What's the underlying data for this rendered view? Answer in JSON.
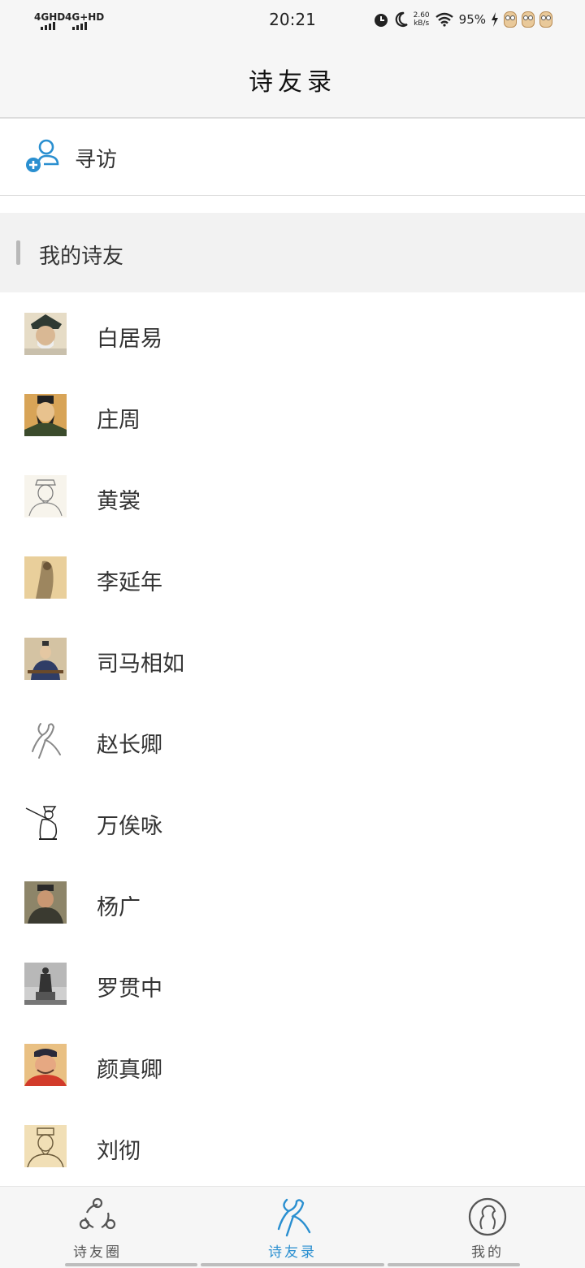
{
  "status_bar": {
    "signal_1": "4GHD",
    "signal_2": "4G+HD",
    "time": "20:21",
    "net_rate": "2.60",
    "net_unit": "kB/s",
    "battery": "95%",
    "icons": [
      "alarm-icon",
      "moon-icon",
      "wifi-icon",
      "charging-icon"
    ]
  },
  "header": {
    "title": "诗友录"
  },
  "visit": {
    "label": "寻访",
    "icon": "add-user-icon",
    "accent_color": "#2a8fd0"
  },
  "section": {
    "title": "我的诗友"
  },
  "friends": [
    {
      "name": "白居易",
      "avatar": "portrait-avatar"
    },
    {
      "name": "庄周",
      "avatar": "portrait-avatar"
    },
    {
      "name": "黄裳",
      "avatar": "sketch-portrait-avatar"
    },
    {
      "name": "李延年",
      "avatar": "portrait-avatar"
    },
    {
      "name": "司马相如",
      "avatar": "portrait-avatar"
    },
    {
      "name": "赵长卿",
      "avatar": "default-figure-avatar"
    },
    {
      "name": "万俟咏",
      "avatar": "ink-figure-avatar"
    },
    {
      "name": "杨广",
      "avatar": "portrait-avatar"
    },
    {
      "name": "罗贯中",
      "avatar": "statue-avatar"
    },
    {
      "name": "颜真卿",
      "avatar": "portrait-avatar"
    },
    {
      "name": "刘彻",
      "avatar": "sketch-portrait-avatar"
    }
  ],
  "bottom_nav": {
    "items": [
      {
        "label": "诗友圈",
        "icon": "share-circle-icon",
        "active": false
      },
      {
        "label": "诗友录",
        "icon": "poet-figure-icon",
        "active": true
      },
      {
        "label": "我的",
        "icon": "profile-circle-icon",
        "active": false
      }
    ],
    "active_color": "#2a8fd0"
  }
}
